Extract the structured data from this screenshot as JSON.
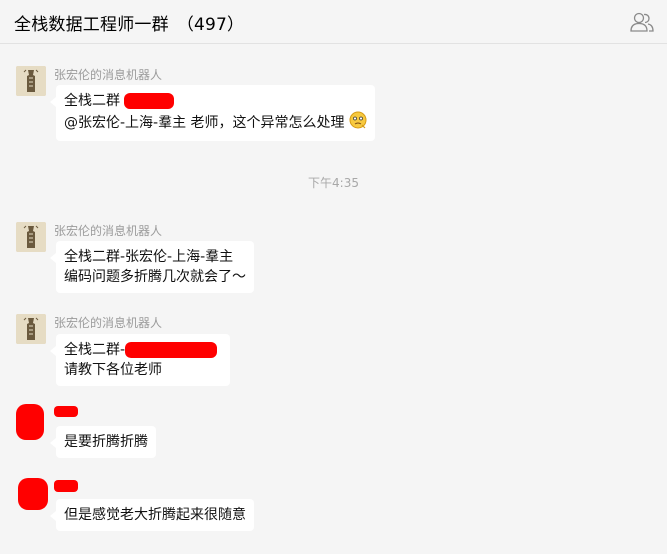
{
  "header": {
    "title": "全栈数据工程师一群",
    "member_count": "（497）",
    "members_icon": "people-icon"
  },
  "messages": [
    {
      "sender": "张宏伦的消息机器人",
      "line1": "全栈二群",
      "line2": "@张宏伦-上海-羣主 老师，这个异常怎么处理",
      "emoji": "thinking-face-icon"
    },
    {
      "time": "下午4:35"
    },
    {
      "sender": "张宏伦的消息机器人",
      "line1": "全栈二群-张宏伦-上海-羣主",
      "line2": "编码问题多折腾几次就会了～"
    },
    {
      "sender": "张宏伦的消息机器人",
      "line1": "全栈二群-",
      "line2": "请教下各位老师"
    },
    {
      "text": "是要折腾折腾"
    },
    {
      "text": "但是感觉老大折腾起来很随意"
    }
  ],
  "colors": {
    "background": "#f5f5f5",
    "bubble": "#ffffff",
    "redaction": "#ff0000",
    "meta_text": "#9b9b9b"
  }
}
